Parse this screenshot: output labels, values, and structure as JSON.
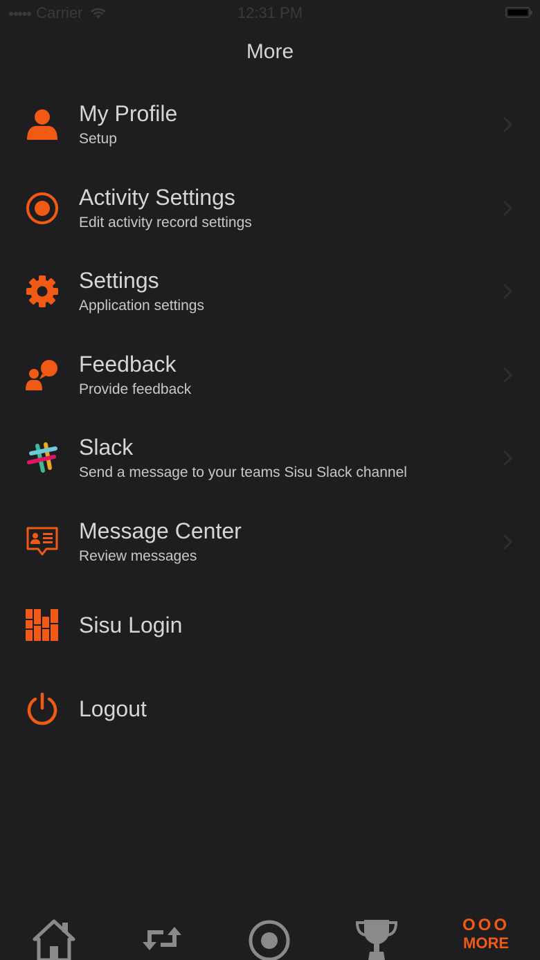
{
  "status_bar": {
    "carrier": "Carrier",
    "time": "12:31 PM"
  },
  "nav": {
    "title": "More"
  },
  "menu": {
    "items": [
      {
        "title": "My Profile",
        "subtitle": "Setup",
        "icon": "person-icon"
      },
      {
        "title": "Activity Settings",
        "subtitle": "Edit activity record settings",
        "icon": "record-icon"
      },
      {
        "title": "Settings",
        "subtitle": "Application settings",
        "icon": "gear-icon"
      },
      {
        "title": "Feedback",
        "subtitle": "Provide feedback",
        "icon": "feedback-icon"
      },
      {
        "title": "Slack",
        "subtitle": "Send a message to your teams Sisu Slack channel",
        "icon": "slack-icon"
      },
      {
        "title": "Message Center",
        "subtitle": "Review messages",
        "icon": "message-icon"
      },
      {
        "title": "Sisu Login",
        "icon": "sisu-logo-icon"
      },
      {
        "title": "Logout",
        "icon": "power-icon"
      }
    ]
  },
  "tab_bar": {
    "tabs": [
      {
        "name": "home",
        "icon": "home-icon"
      },
      {
        "name": "sync",
        "icon": "sync-icon"
      },
      {
        "name": "record",
        "icon": "record-icon"
      },
      {
        "name": "trophy",
        "icon": "trophy-icon"
      },
      {
        "name": "more",
        "label": "MORE",
        "dots": "OOO",
        "icon": "more-icon",
        "selected": true
      }
    ]
  },
  "colors": {
    "accent": "#f05a14",
    "background": "#1e1e20",
    "text": "#d6d6d6",
    "tab_inactive": "#8a8a8a"
  }
}
